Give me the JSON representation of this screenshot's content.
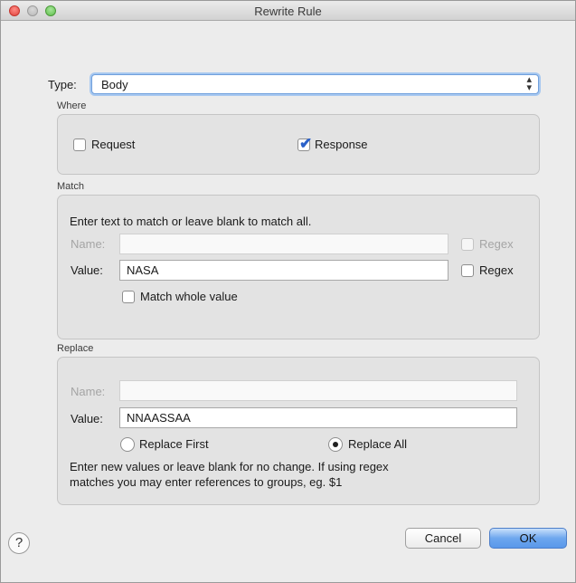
{
  "window": {
    "title": "Rewrite Rule"
  },
  "type": {
    "label": "Type:",
    "value": "Body"
  },
  "where": {
    "title": "Where",
    "request_label": "Request",
    "request_checked": false,
    "response_label": "Response",
    "response_checked": true
  },
  "match": {
    "title": "Match",
    "instructions": "Enter text to match or leave blank to match all.",
    "name_label": "Name:",
    "name_value": "",
    "name_regex_label": "Regex",
    "name_regex_checked": false,
    "value_label": "Value:",
    "value_value": "NASA",
    "value_regex_label": "Regex",
    "value_regex_checked": false,
    "whole_value_label": "Match whole value",
    "whole_value_checked": false
  },
  "replace": {
    "title": "Replace",
    "name_label": "Name:",
    "name_value": "",
    "value_label": "Value:",
    "value_value": "NNAASSAA",
    "replace_first_label": "Replace First",
    "replace_all_label": "Replace All",
    "selected": "Replace All",
    "help_line1": "Enter new values or leave blank for no change. If using regex",
    "help_line2": "matches you may enter references to groups, eg. $1"
  },
  "footer": {
    "help_label": "?",
    "cancel_label": "Cancel",
    "ok_label": "OK"
  }
}
